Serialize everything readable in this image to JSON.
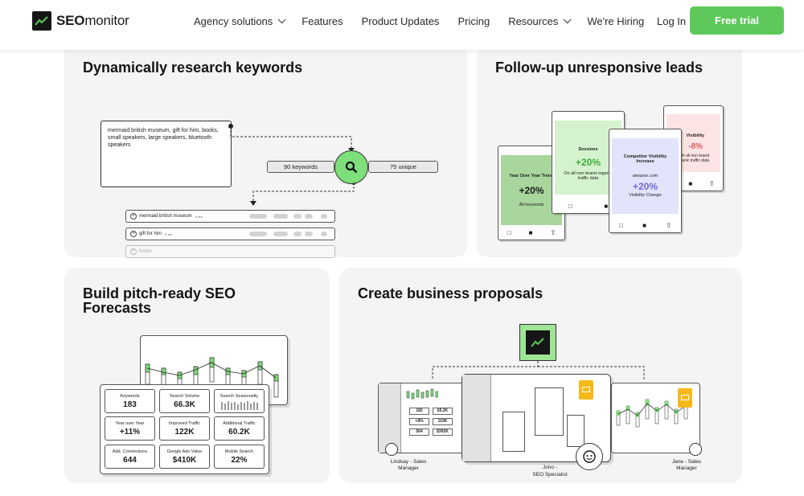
{
  "header": {
    "brand_bold": "SEO",
    "brand_rest": "monitor",
    "nav": [
      {
        "label": "Agency solutions",
        "dropdown": true
      },
      {
        "label": "Features",
        "dropdown": false
      },
      {
        "label": "Product Updates",
        "dropdown": false
      },
      {
        "label": "Pricing",
        "dropdown": false
      },
      {
        "label": "Resources",
        "dropdown": true
      },
      {
        "label": "We're Hiring",
        "dropdown": false
      }
    ],
    "login": "Log In",
    "cta": "Free trial"
  },
  "colors": {
    "accent": "#5ec95a",
    "card_bg": "#f4f4f4",
    "negative": "#e05a5a",
    "purple": "#6f6bd8"
  },
  "cards": {
    "research": {
      "title": "Dynamically research keywords",
      "input_text": "mermaid british museum, gift for him, books, small speakers, large speakers, bluetooth speakers",
      "keywords_count": "90 keywords",
      "unique_count": "75 unique",
      "rows": [
        {
          "keyword": "mermaid british museum",
          "tag": "fr aut"
        },
        {
          "keyword": "gift for him",
          "tag": "fr aut"
        },
        {
          "keyword": "books",
          "tag": ""
        }
      ]
    },
    "followup": {
      "title": "Follow-up unresponsive leads",
      "cards": [
        {
          "label": "Year Over Year Trend",
          "value": "+20%",
          "note": "All keywords"
        },
        {
          "label": "Sessions",
          "value": "+20%",
          "note": "On all non brand organic traffic data"
        },
        {
          "label": "Competitor Visibility Increase",
          "sub": "amazon.com",
          "value": "+20%",
          "note": "Visibility Change"
        },
        {
          "label": "Visibility",
          "value": "-8%",
          "note": "On all non brand organic traffic data"
        }
      ]
    },
    "forecasts": {
      "title": "Build pitch-ready SEO Forecasts",
      "stats": [
        {
          "label": "Keywords",
          "value": "183"
        },
        {
          "label": "Search Volume",
          "value": "66.3K"
        },
        {
          "label": "Search Seasonality",
          "value": ""
        },
        {
          "label": "Year over Year",
          "value": "+11%"
        },
        {
          "label": "Improved Traffic",
          "value": "122K"
        },
        {
          "label": "Additional Traffic",
          "value": "60.2K"
        },
        {
          "label": "Add. Conversions",
          "value": "644"
        },
        {
          "label": "Google Ads Value",
          "value": "$410K"
        },
        {
          "label": "Mobile Search",
          "value": "22%"
        }
      ]
    },
    "proposals": {
      "title": "Create business proposals",
      "left_person": "Lindsay - Sales Manager",
      "center_person_name": "Jono -",
      "center_person_role": "SEO Specialist",
      "right_person": "Jane - Sales Manager",
      "mini_stats": [
        "182",
        "65.2K",
        "+8%",
        "119K",
        "564",
        "$392K"
      ]
    }
  }
}
